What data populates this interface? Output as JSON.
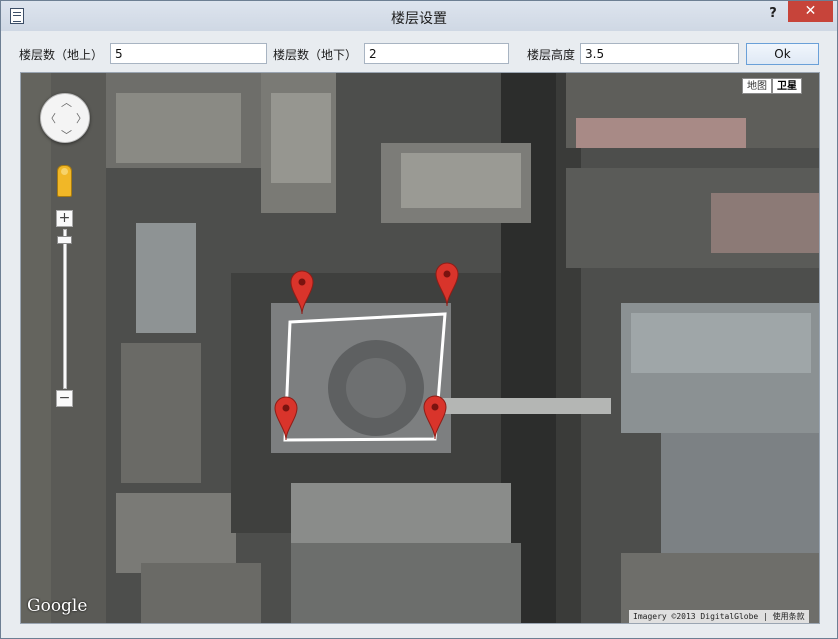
{
  "window": {
    "title": "楼层设置",
    "help_label": "?",
    "close_label": "✕"
  },
  "toolbar": {
    "floors_above_label": "楼层数（地上）",
    "floors_above_value": "5",
    "floors_below_label": "楼层数（地下）",
    "floors_below_value": "2",
    "floor_height_label": "楼层高度",
    "floor_height_value": "3.5",
    "ok_label": "Ok"
  },
  "map": {
    "map_type_buttons": [
      "地图",
      "卫星"
    ],
    "active_map_type": "卫星",
    "logo_text": "Google",
    "attribution_text": "Imagery ©2013 DigitalGlobe | 使用条款",
    "marker_color": "#d9342b",
    "polygon_color": "#ffffff",
    "marker_count": 4
  },
  "colors": {
    "close_button": "#c7443a",
    "ok_button_border": "#6aa0d8",
    "window_bg": "#e8ecf0"
  }
}
